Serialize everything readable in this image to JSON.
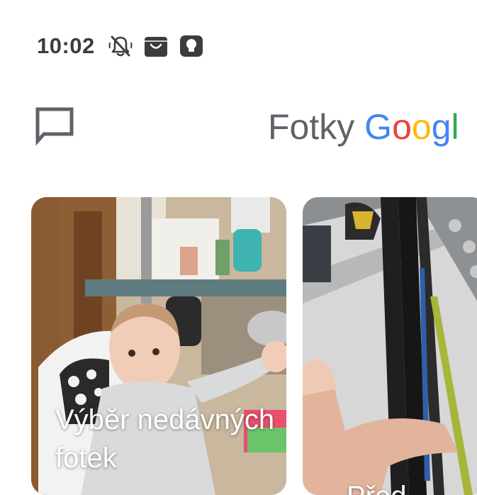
{
  "status_bar": {
    "time": "10:02",
    "icons": [
      "bell-off-icon",
      "shopping-bag-icon",
      "lightbulb-icon"
    ]
  },
  "header": {
    "chat_icon": "chat-bubble-icon",
    "app_name": "Fotky",
    "brand_letters": [
      {
        "char": "G",
        "color": "#4285F4"
      },
      {
        "char": "o",
        "color": "#EA4335"
      },
      {
        "char": "o",
        "color": "#FBBC05"
      },
      {
        "char": "g",
        "color": "#4285F4"
      },
      {
        "char": "l",
        "color": "#34A853"
      }
    ]
  },
  "cards": [
    {
      "title": "Výběr nedávných fotek",
      "image": "baby-in-high-chair-photo"
    },
    {
      "title": "Před",
      "image": "hand-holding-black-cables-photo"
    }
  ]
}
